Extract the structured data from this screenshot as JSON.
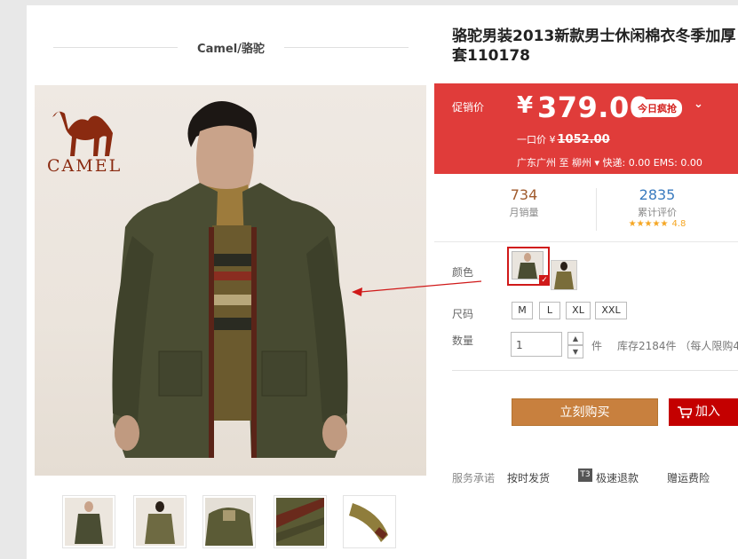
{
  "brand": {
    "name": "Camel/骆驼"
  },
  "logo": {
    "text": "CAMEL"
  },
  "product": {
    "title_line1": "骆驼男装2013新款男士休闲棉衣冬季加厚",
    "title_line2": "套110178"
  },
  "price": {
    "label": "促销价",
    "currency": "¥",
    "amount": "379.00",
    "badge": "今日疯抢",
    "original_label": "一口价 ¥",
    "original_amount": "1052.00",
    "shipping": "广东广州  至   柳州 ▾  快递: 0.00 EMS: 0.00"
  },
  "stats": {
    "sales_count": "734",
    "sales_label": "月销量",
    "reviews_count": "2835",
    "reviews_label": "累计评价",
    "rating_stars": "★★★★★",
    "rating": "4.8"
  },
  "options": {
    "color_label": "颜色",
    "size_label": "尺码",
    "sizes": [
      "M",
      "L",
      "XL",
      "XXL"
    ],
    "qty_label": "数量",
    "qty_value": "1",
    "unit": "件",
    "stock": "库存2184件 （每人限购4"
  },
  "actions": {
    "buy_now": "立刻购买",
    "add_to_cart": "加入"
  },
  "service": {
    "label": "服务承诺",
    "item1": "按时发货",
    "t3": "T3",
    "item2": "极速退款",
    "item3": "赠运费险"
  },
  "colors": {
    "price_bg": "#e03c3a",
    "buy_button": "#c8803e",
    "cart_button": "#c40000",
    "selected_border": "#d01919"
  }
}
